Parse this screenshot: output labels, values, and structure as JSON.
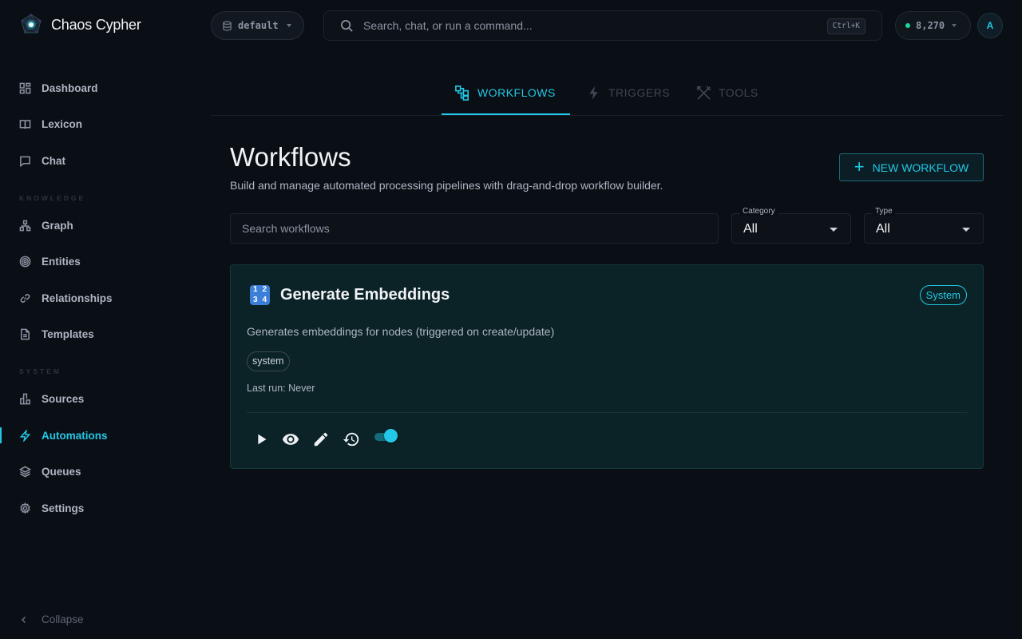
{
  "app": {
    "name": "Chaos Cypher"
  },
  "sidebar": {
    "items": [
      {
        "label": "Dashboard",
        "icon": "dashboard-icon"
      },
      {
        "label": "Lexicon",
        "icon": "book-icon"
      },
      {
        "label": "Chat",
        "icon": "chat-icon"
      },
      {
        "label": "Graph",
        "icon": "graph-icon"
      },
      {
        "label": "Entities",
        "icon": "target-icon"
      },
      {
        "label": "Relationships",
        "icon": "link-icon"
      },
      {
        "label": "Templates",
        "icon": "document-icon"
      },
      {
        "label": "Sources",
        "icon": "sources-icon"
      },
      {
        "label": "Automations",
        "icon": "bolt-icon",
        "active": true
      },
      {
        "label": "Queues",
        "icon": "layers-icon"
      },
      {
        "label": "Settings",
        "icon": "gear-icon"
      }
    ],
    "sections": {
      "knowledge": "KNOWLEDGE",
      "system": "SYSTEM"
    },
    "collapse_label": "Collapse"
  },
  "topbar": {
    "workspace": "default",
    "search_placeholder": "Search, chat, or run a command...",
    "shortcut": "Ctrl+K",
    "credits": "8,270",
    "avatar_initial": "A"
  },
  "tabs": [
    {
      "label": "WORKFLOWS",
      "active": true
    },
    {
      "label": "TRIGGERS",
      "active": false
    },
    {
      "label": "TOOLS",
      "active": false
    }
  ],
  "page": {
    "title": "Workflows",
    "subtitle": "Build and manage automated processing pipelines with drag-and-drop workflow builder.",
    "new_button": "NEW WORKFLOW"
  },
  "filters": {
    "search_placeholder": "Search workflows",
    "category": {
      "label": "Category",
      "value": "All"
    },
    "type": {
      "label": "Type",
      "value": "All"
    }
  },
  "workflows": [
    {
      "emoji": [
        "1",
        "2",
        "3",
        "4"
      ],
      "title": "Generate Embeddings",
      "chip": "System",
      "description": "Generates embeddings for nodes (triggered on create/update)",
      "tag": "system",
      "last_run": "Last run: Never",
      "enabled": true
    }
  ],
  "colors": {
    "accent": "#22c8e6",
    "background": "#0a0e15",
    "card_background": "#0b2226",
    "credits_dot": "#20d59a"
  }
}
